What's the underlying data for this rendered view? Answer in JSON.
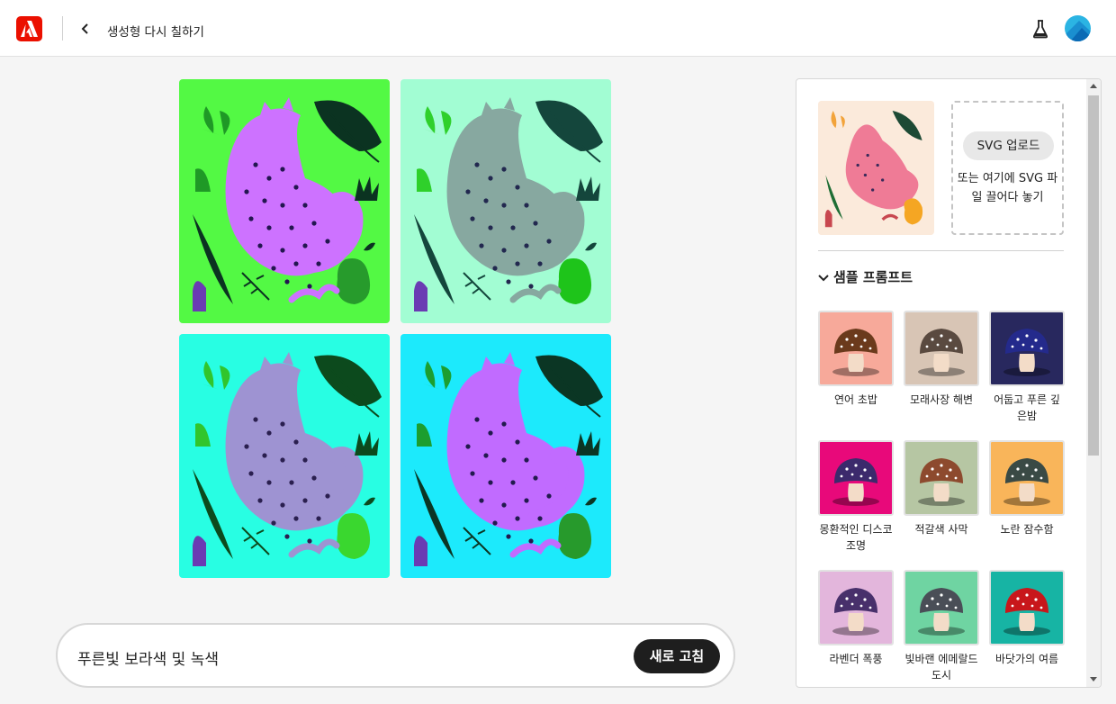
{
  "header": {
    "title": "생성형 다시 칠하기",
    "logo_icon": "adobe-logo",
    "back_icon": "chevron-left-icon",
    "labs_icon": "flask-icon",
    "avatar_icon": "user-avatar"
  },
  "variations": [
    {
      "bg": "#53f944",
      "body": "#cd72ff",
      "dark": "#0b3321",
      "leaf": "#1f9926",
      "pear": "#279b2c",
      "spots": "#231650"
    },
    {
      "bg": "#a2fdd3",
      "body": "#87a8a0",
      "dark": "#14463c",
      "leaf": "#2fd02b",
      "pear": "#1ec41a",
      "spots": "#22284f"
    },
    {
      "bg": "#28fee3",
      "body": "#9e93d2",
      "dark": "#0c4a1d",
      "leaf": "#31c52c",
      "pear": "#3ad72f",
      "spots": "#2a1f4f"
    },
    {
      "bg": "#1ceafc",
      "body": "#c16bff",
      "dark": "#0b3624",
      "leaf": "#1c9e2f",
      "pear": "#279a2c",
      "spots": "#221a4e"
    }
  ],
  "prompt": {
    "text": "푸른빛 보라색 및 녹색",
    "button": "새로 고침"
  },
  "panel": {
    "upload_button": "SVG 업로드",
    "upload_hint": "또는 여기에 SVG 파일 끌어다 놓기",
    "section_title": "샘플 프롬프트",
    "samples": [
      {
        "label": "연어 초밥",
        "bg": "#f7a99a",
        "cap": "#6b3a1c"
      },
      {
        "label": "모래사장 해변",
        "bg": "#d8c5b5",
        "cap": "#5a4a40"
      },
      {
        "label": "어둡고 푸른 깊은밤",
        "bg": "#28285e",
        "cap": "#242a8c"
      },
      {
        "label": "몽환적인 디스코 조명",
        "bg": "#e8097a",
        "cap": "#3c2a6c"
      },
      {
        "label": "적갈색 사막",
        "bg": "#b6c6a3",
        "cap": "#8d4a2e"
      },
      {
        "label": "노란 잠수함",
        "bg": "#f9b55a",
        "cap": "#3a4a45"
      },
      {
        "label": "라벤더 폭풍",
        "bg": "#e3b6dc",
        "cap": "#48306b"
      },
      {
        "label": "빛바랜 에메랄드 도시",
        "bg": "#6fd4a2",
        "cap": "#4a4e57"
      },
      {
        "label": "바닷가의 여름",
        "bg": "#17b4a4",
        "cap": "#c8171b"
      }
    ]
  }
}
